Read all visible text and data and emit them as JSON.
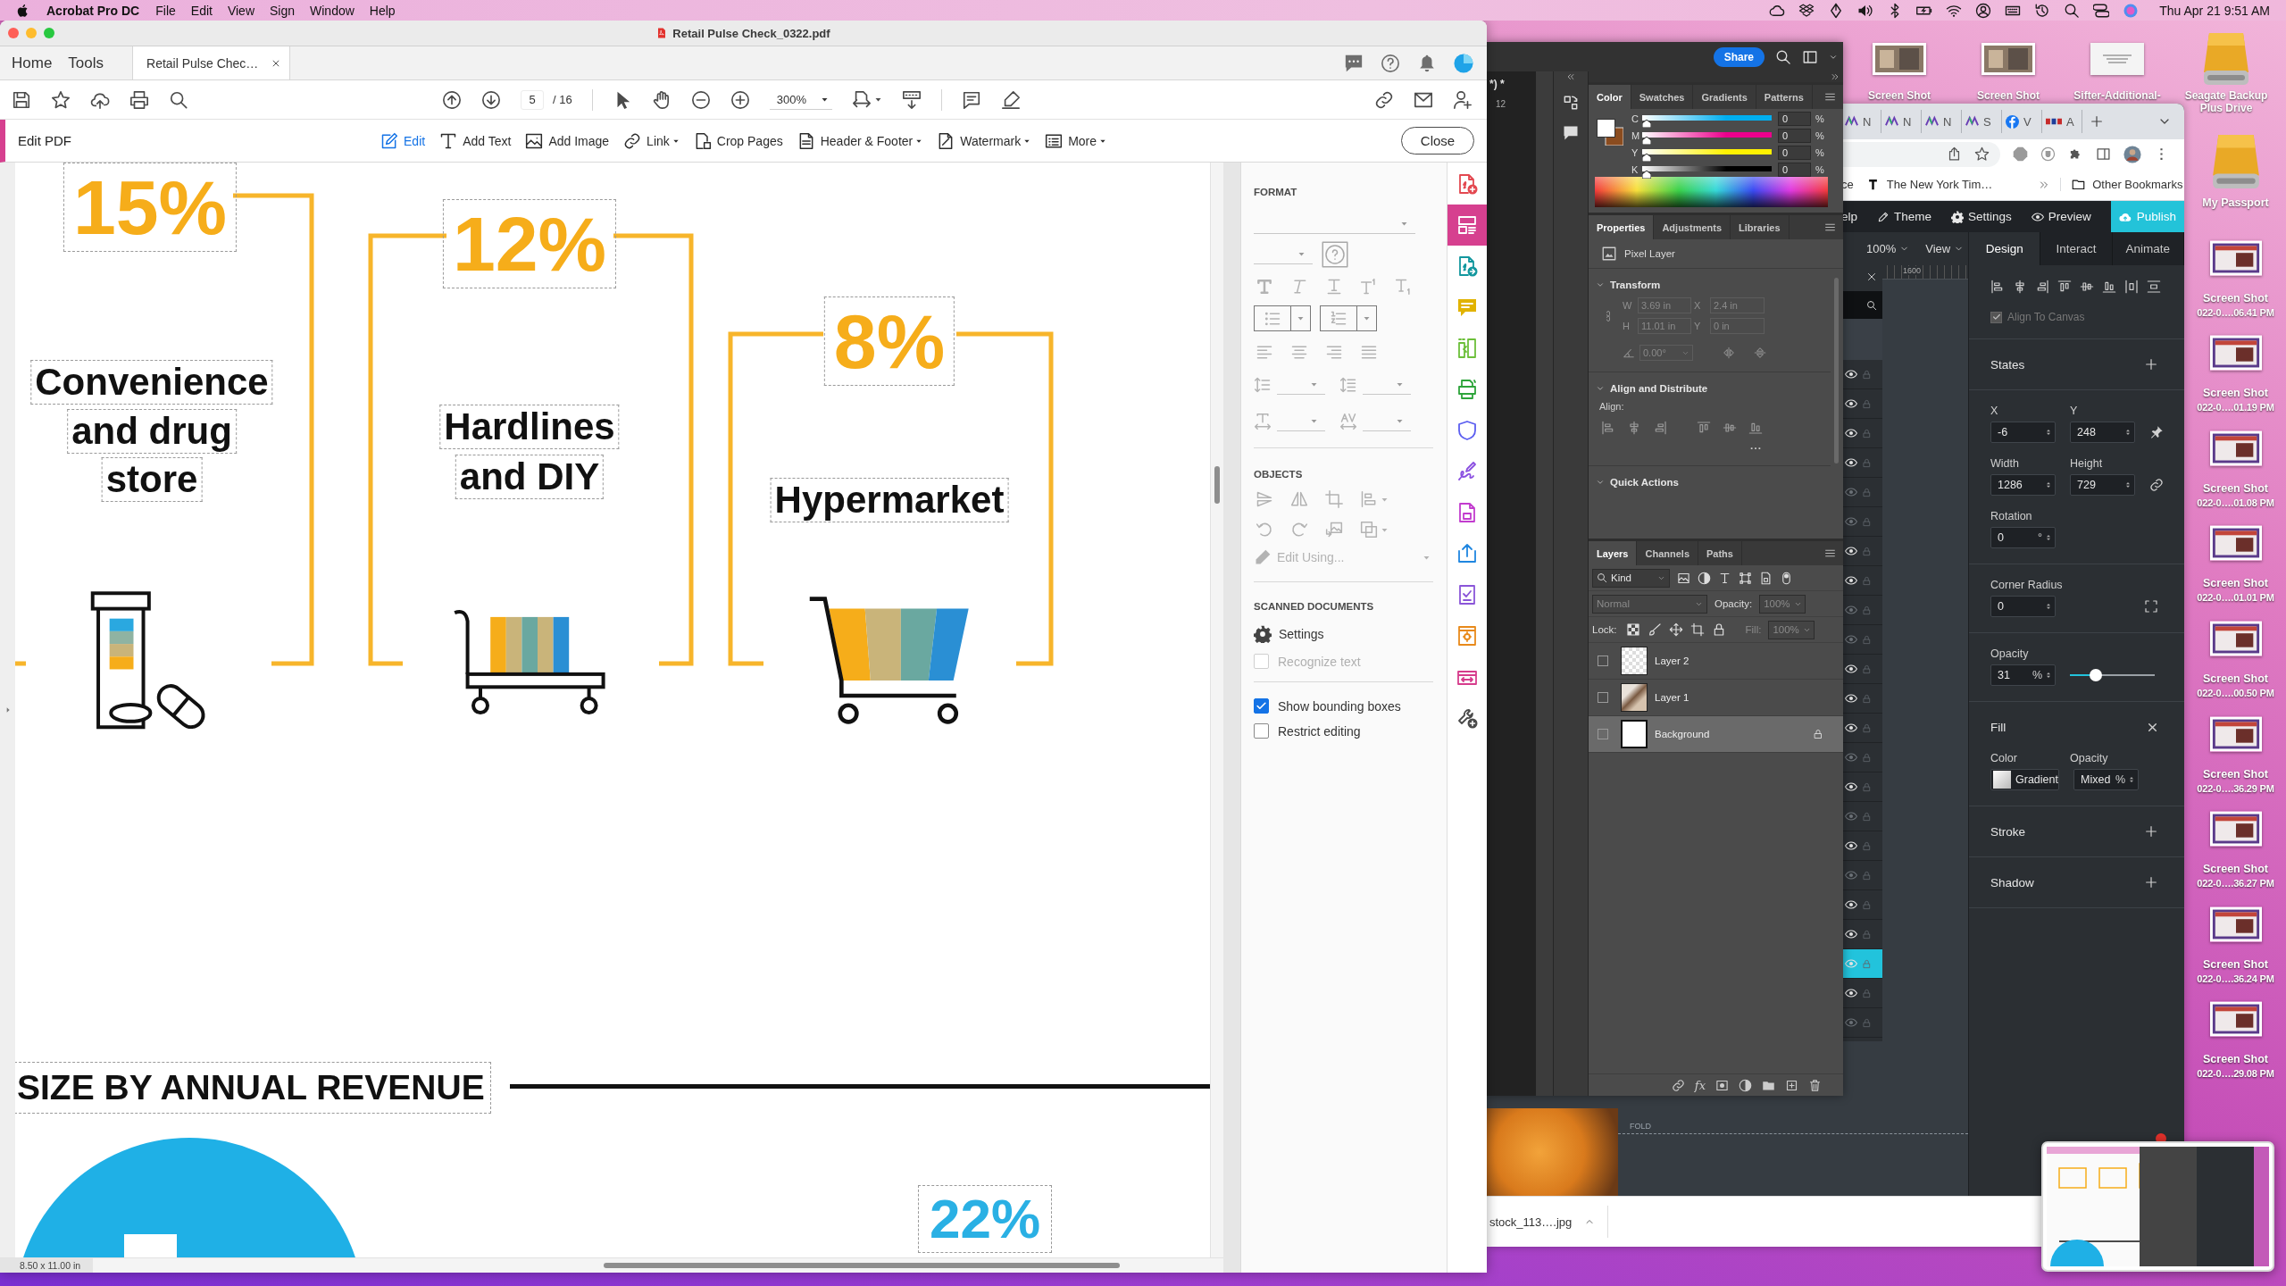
{
  "menu_bar": {
    "app": "Acrobat Pro DC",
    "menus": [
      "File",
      "Edit",
      "View",
      "Sign",
      "Window",
      "Help"
    ],
    "clock": "Thu Apr 21 9:51 AM"
  },
  "desktop": {
    "top_icons": [
      {
        "kind": "screenshot",
        "label": "Screen Shot"
      },
      {
        "kind": "screenshot",
        "label": "Screen Shot"
      },
      {
        "kind": "document",
        "label": "Sifter-Additional-"
      },
      {
        "kind": "drive",
        "label": "Seagate Backup Plus Drive"
      }
    ],
    "side_icons": [
      {
        "kind": "drive",
        "label": "My Passport"
      },
      {
        "kind": "screenshot",
        "label": "Screen Shot",
        "sublabel": "022-0….06.41 PM"
      },
      {
        "kind": "screenshot",
        "label": "Screen Shot",
        "sublabel": "022-0….01.19 PM"
      },
      {
        "kind": "screenshot",
        "label": "Screen Shot",
        "sublabel": "022-0….01.08 PM"
      },
      {
        "kind": "screenshot",
        "label": "Screen Shot",
        "sublabel": "022-0….01.01 PM"
      },
      {
        "kind": "screenshot",
        "label": "Screen Shot",
        "sublabel": "022-0….00.50 PM"
      },
      {
        "kind": "screenshot",
        "label": "Screen Shot",
        "sublabel": "022-0….36.29 PM"
      },
      {
        "kind": "screenshot",
        "label": "Screen Shot",
        "sublabel": "022-0….36.27 PM"
      },
      {
        "kind": "screenshot",
        "label": "Screen Shot",
        "sublabel": "022-0….36.24 PM"
      },
      {
        "kind": "screenshot",
        "label": "Screen Shot",
        "sublabel": "022-0….29.08 PM"
      }
    ]
  },
  "acrobat": {
    "title": "Retail Pulse Check_0322.pdf",
    "nav": [
      {
        "label": "Home",
        "selected": false
      },
      {
        "label": "Tools",
        "selected": false
      }
    ],
    "doc_tab": {
      "label": "Retail Pulse Chec…",
      "selected": true
    },
    "page_current": "5",
    "page_total": "/ 16",
    "zoom": "300%",
    "edit_bar": {
      "title": "Edit PDF",
      "tools": [
        {
          "label": "Edit",
          "selected": true,
          "menu": false
        },
        {
          "label": "Add Text",
          "selected": false,
          "menu": false
        },
        {
          "label": "Add Image",
          "selected": false,
          "menu": false
        },
        {
          "label": "Link",
          "selected": false,
          "menu": true
        },
        {
          "label": "Crop Pages",
          "selected": false,
          "menu": false
        },
        {
          "label": "Header & Footer",
          "selected": false,
          "menu": true
        },
        {
          "label": "Watermark",
          "selected": false,
          "menu": true
        },
        {
          "label": "More",
          "selected": false,
          "menu": true
        }
      ],
      "close": "Close"
    },
    "document": {
      "stats": [
        {
          "value": "15%",
          "lines": [
            "Convenience",
            "and drug",
            "store"
          ]
        },
        {
          "value": "12%",
          "lines": [
            "Hardlines",
            "and DIY"
          ]
        },
        {
          "value": "8%",
          "lines": [
            "Hypermarket"
          ]
        }
      ],
      "heading": "SIZE BY ANNUAL REVENUE",
      "next_value": "22%",
      "page_size": "8.50 x 11.00 in"
    },
    "format_panel": {
      "format_title": "FORMAT",
      "objects_title": "OBJECTS",
      "edit_using": "Edit Using...",
      "scanned_title": "SCANNED DOCUMENTS",
      "settings": "Settings",
      "options": [
        {
          "label": "Recognize text",
          "checked": false,
          "disabled": true
        },
        {
          "label": "Show bounding boxes",
          "checked": true,
          "disabled": false
        },
        {
          "label": "Restrict editing",
          "checked": false,
          "disabled": false
        }
      ]
    },
    "tool_strip": [
      {
        "selected": false
      },
      {
        "selected": true
      },
      {
        "selected": false
      },
      {
        "selected": false
      },
      {
        "selected": false
      },
      {
        "selected": false
      },
      {
        "selected": false
      },
      {
        "selected": false
      },
      {
        "selected": false
      },
      {
        "selected": false
      },
      {
        "selected": false
      },
      {
        "selected": false
      },
      {
        "selected": false
      },
      {
        "selected": false
      }
    ]
  },
  "photoshop": {
    "share": "Share",
    "doc_tab": "*) *",
    "ruler_mark": "12",
    "color_tabs": [
      {
        "label": "Color",
        "selected": true
      },
      {
        "label": "Swatches",
        "selected": false
      },
      {
        "label": "Gradients",
        "selected": false
      },
      {
        "label": "Patterns",
        "selected": false
      }
    ],
    "channels": [
      {
        "name": "C",
        "color": "#00aeef",
        "level": 0,
        "value": "0",
        "unit": "%"
      },
      {
        "name": "M",
        "color": "#ec008c",
        "level": 0,
        "value": "0",
        "unit": "%"
      },
      {
        "name": "Y",
        "color": "#fff200",
        "level": 0,
        "value": "0",
        "unit": "%"
      },
      {
        "name": "K",
        "color": "#000000",
        "level": 0,
        "value": "0",
        "unit": "%"
      }
    ],
    "properties_tabs": [
      {
        "label": "Properties",
        "selected": true
      },
      {
        "label": "Adjustments",
        "selected": false
      },
      {
        "label": "Libraries",
        "selected": false
      }
    ],
    "layer_kind": "Pixel Layer",
    "transform": {
      "title": "Transform",
      "fields": [
        {
          "label": "W",
          "value": "3.69 in"
        },
        {
          "label": "X",
          "value": "2.4 in"
        },
        {
          "label": "H",
          "value": "11.01 in"
        },
        {
          "label": "Y",
          "value": "0 in"
        }
      ],
      "angle": "0.00°"
    },
    "align": {
      "title": "Align and Distribute",
      "label": "Align:"
    },
    "quick_actions": "Quick Actions",
    "layers_tabs": [
      {
        "label": "Layers",
        "selected": true
      },
      {
        "label": "Channels",
        "selected": false
      },
      {
        "label": "Paths",
        "selected": false
      }
    ],
    "filter": "Kind",
    "blend_mode": "Normal",
    "opacity_label": "Opacity:",
    "opacity": "100%",
    "lock_label": "Lock:",
    "fill_label": "Fill:",
    "fill": "100%",
    "layers": [
      {
        "name": "Layer 2",
        "kind": "cutout",
        "selected": false,
        "locked": false
      },
      {
        "name": "Layer 1",
        "kind": "photo",
        "selected": false,
        "locked": false
      },
      {
        "name": "Background",
        "kind": "fill",
        "selected": true,
        "locked": true
      }
    ],
    "effects_label": "fx"
  },
  "browser": {
    "tabs": [
      {
        "kind": "logo",
        "letter": "N"
      },
      {
        "kind": "logo",
        "letter": "N"
      },
      {
        "kind": "logo",
        "letter": "N"
      },
      {
        "kind": "logo",
        "letter": "S"
      },
      {
        "kind": "circle",
        "letter": "V"
      },
      {
        "kind": "wordmark",
        "letter": "A"
      }
    ],
    "bookmarks": [
      {
        "kind": "plain",
        "label": "ce"
      },
      {
        "kind": "logo",
        "label": "The New York Tim…"
      }
    ],
    "other_bookmarks": "Other Bookmarks",
    "toolbar": [
      {
        "kind": "plain",
        "label": "elp"
      },
      {
        "kind": "pencil",
        "label": "Theme"
      },
      {
        "kind": "gear",
        "label": "Settings"
      },
      {
        "kind": "eye",
        "label": "Preview"
      }
    ],
    "publish": "Publish",
    "zoom": "100%",
    "view": "View",
    "ruler_mark": "1600",
    "panel_tabs": [
      {
        "label": "Design",
        "selected": true
      },
      {
        "label": "Interact",
        "selected": false
      },
      {
        "label": "Animate",
        "selected": false
      }
    ],
    "align_to_canvas": {
      "label": "Align To Canvas",
      "checked": true
    },
    "states": "States",
    "position": [
      {
        "label": "X",
        "value": "-6"
      },
      {
        "label": "Y",
        "value": "248"
      }
    ],
    "size": [
      {
        "label": "Width",
        "value": "1286"
      },
      {
        "label": "Height",
        "value": "729"
      }
    ],
    "rotation": {
      "label": "Rotation",
      "value": "0",
      "unit": "°"
    },
    "corner_radius": {
      "label": "Corner Radius",
      "value": "0"
    },
    "opacity": {
      "label": "Opacity",
      "value": "31",
      "unit": "%",
      "level": 0.31
    },
    "fill": {
      "label": "Fill",
      "color_label": "Color",
      "color_value": "Gradient",
      "opacity_label": "Opacity",
      "opacity_value": "Mixed",
      "unit": "%"
    },
    "stroke": "Stroke",
    "shadow": "Shadow",
    "layer_rows": [
      {
        "visible": true,
        "selected": false
      },
      {
        "visible": true,
        "selected": false
      },
      {
        "visible": true,
        "selected": false
      },
      {
        "visible": true,
        "selected": false
      },
      {
        "visible": false,
        "selected": false
      },
      {
        "visible": false,
        "selected": false
      },
      {
        "visible": true,
        "selected": false
      },
      {
        "visible": true,
        "selected": false
      },
      {
        "visible": false,
        "selected": false
      },
      {
        "visible": false,
        "selected": false
      },
      {
        "visible": true,
        "selected": false
      },
      {
        "visible": true,
        "selected": false
      },
      {
        "visible": true,
        "selected": false
      },
      {
        "visible": false,
        "selected": false
      },
      {
        "visible": true,
        "selected": false
      },
      {
        "visible": false,
        "selected": false
      },
      {
        "visible": true,
        "selected": false
      },
      {
        "visible": false,
        "selected": false
      },
      {
        "visible": true,
        "selected": false
      },
      {
        "visible": true,
        "selected": false
      },
      {
        "visible": true,
        "selected": true
      },
      {
        "visible": true,
        "selected": false
      },
      {
        "visible": false,
        "selected": false
      }
    ],
    "canvas_label": "FOLD",
    "download": "stock_113….jpg"
  }
}
